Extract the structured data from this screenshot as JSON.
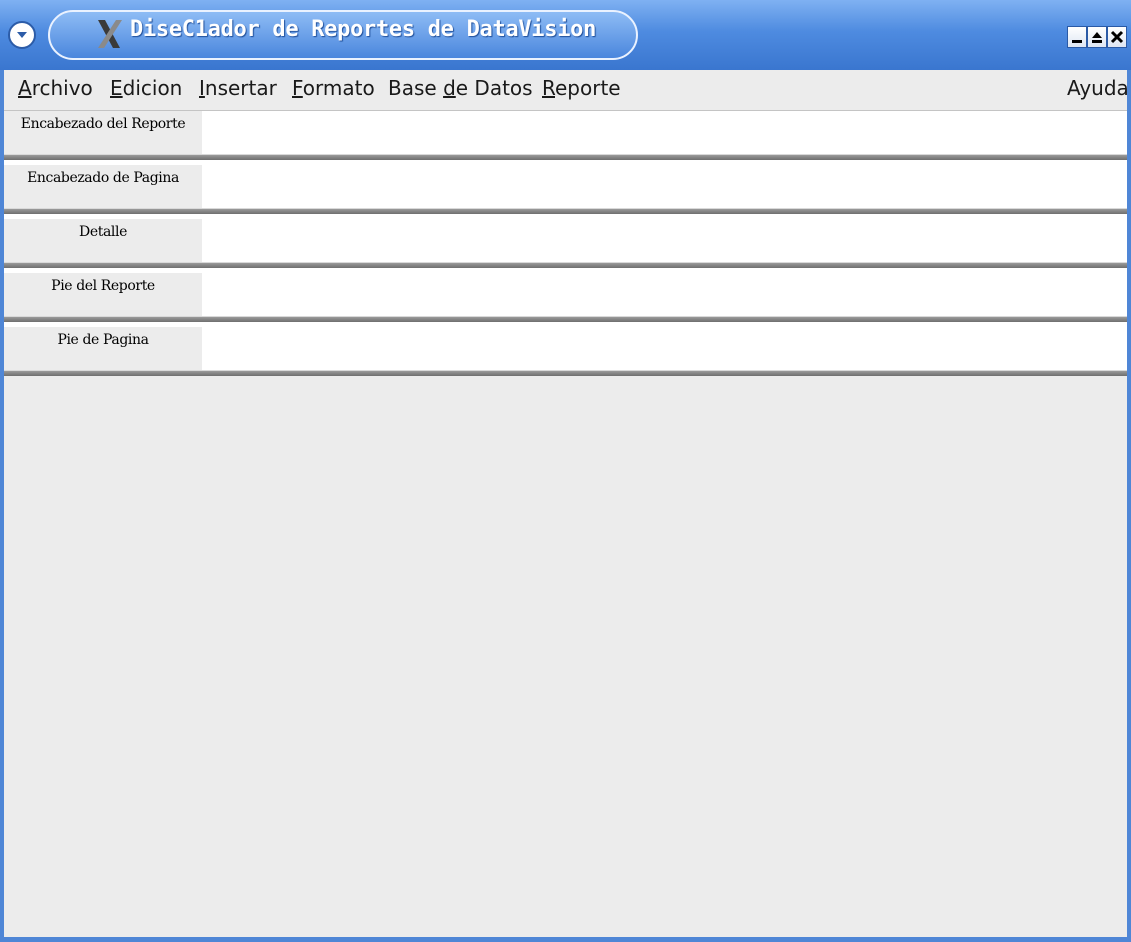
{
  "window": {
    "title": "DiseC1ador de Reportes de DataVision",
    "icons": {
      "menu": "chevron-down-icon",
      "app": "x-logo-icon",
      "minimize": "minimize-icon",
      "maximize": "maximize-icon",
      "close": "close-icon"
    },
    "accent_color": "#4f86d6"
  },
  "menubar": {
    "items": [
      {
        "accel": "A",
        "rest": "rchivo"
      },
      {
        "accel": "E",
        "rest": "dicion"
      },
      {
        "accel": "I",
        "rest": "nsertar"
      },
      {
        "accel": "F",
        "rest": "ormato"
      },
      {
        "pre": "Base ",
        "accel": "d",
        "rest": "e Datos"
      },
      {
        "accel": "R",
        "rest": "eporte"
      }
    ],
    "help": "Ayuda"
  },
  "bands": [
    {
      "label": "Encabezado del Reporte"
    },
    {
      "label": "Encabezado de Pagina"
    },
    {
      "label": "Detalle"
    },
    {
      "label": "Pie del Reporte"
    },
    {
      "label": "Pie de Pagina"
    }
  ]
}
